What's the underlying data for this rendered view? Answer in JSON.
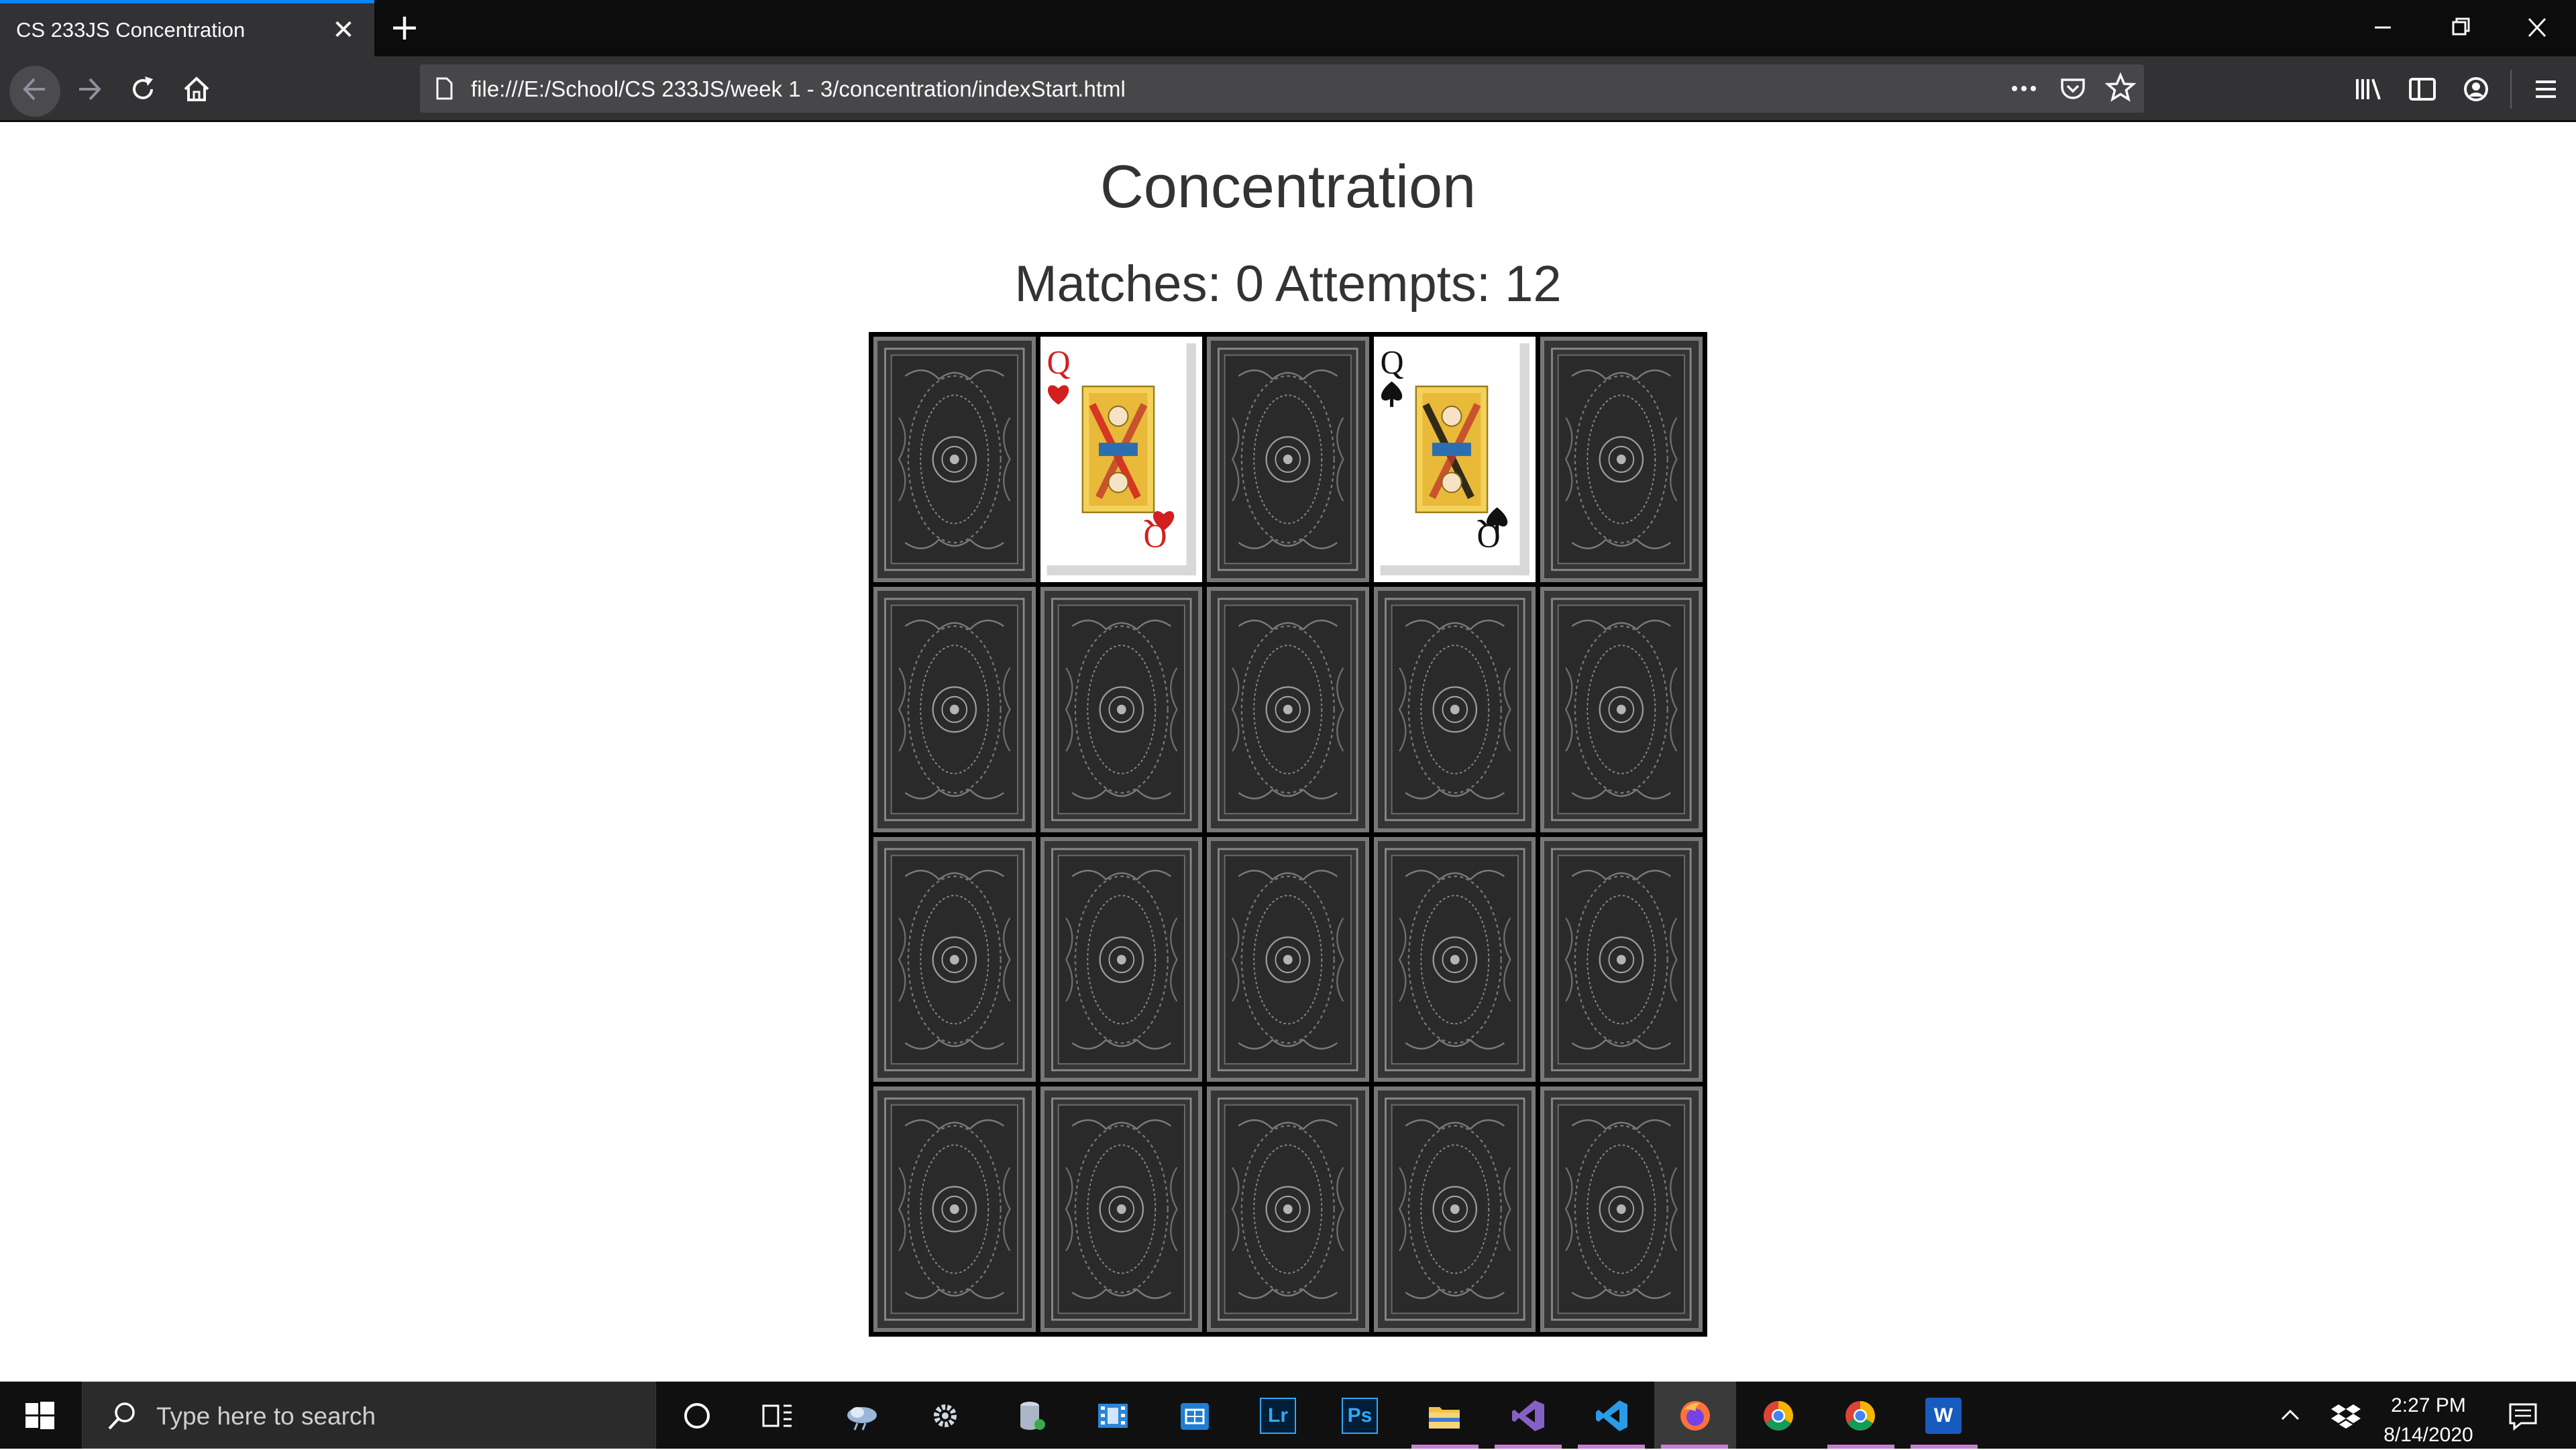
{
  "browser": {
    "tab_title": "CS 233JS Concentration",
    "url": "file:///E:/School/CS 233JS/week 1 - 3/concentration/indexStart.html"
  },
  "page": {
    "title": "Concentration",
    "status": "Matches: 0 Attempts: 12"
  },
  "board": {
    "rows": 4,
    "cols": 5,
    "face_up": [
      {
        "index": 1,
        "rank": "Q",
        "suit": "hearts",
        "color": "#d21f1f"
      },
      {
        "index": 3,
        "rank": "Q",
        "suit": "spades",
        "color": "#111111"
      }
    ]
  },
  "taskbar": {
    "search_placeholder": "Type here to search",
    "time": "2:27 PM",
    "date": "8/14/2020",
    "apps": [
      "Lr",
      "Ps",
      "W"
    ]
  },
  "colors": {
    "tab_accent": "#0a84ff",
    "chrome_dark": "#0c0c0d",
    "toolbar": "#323234",
    "card_back": "#3c3c3c"
  }
}
